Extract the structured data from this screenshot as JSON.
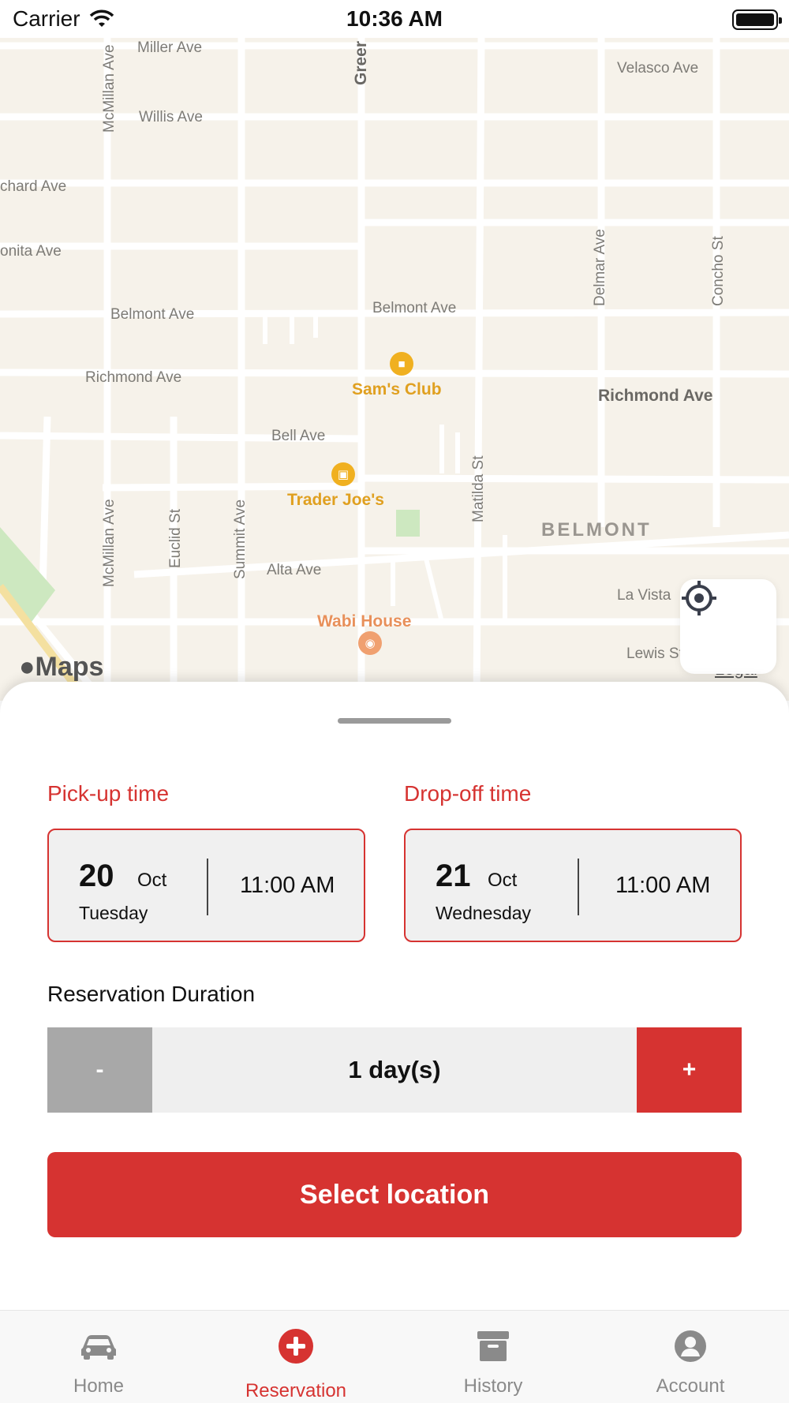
{
  "status_bar": {
    "carrier": "Carrier",
    "time": "10:36 AM"
  },
  "map": {
    "streets": {
      "miller": "Miller Ave",
      "willis": "Willis Ave",
      "orchard": "chard Ave",
      "bonita": "onita Ave",
      "belmont_w": "Belmont Ave",
      "belmont_e": "Belmont Ave",
      "richmond_w": "Richmond Ave",
      "richmond_e": "Richmond Ave",
      "bell": "Bell Ave",
      "alta": "Alta Ave",
      "velasco": "Velasco Ave",
      "la_vista": "La Vista",
      "lewis": "Lewis St",
      "mcmillan_n": "McMillan Ave",
      "mcmillan_s": "McMillan Ave",
      "euclid": "Euclid St",
      "summit": "Summit Ave",
      "matilda": "Matilda St",
      "delmar": "Delmar Ave",
      "concho": "Concho St",
      "greer": "Greer"
    },
    "district": "BELMONT",
    "pois": {
      "sams_club": "Sam's Club",
      "trader_joes": "Trader Joe's",
      "wabi_house": "Wabi House"
    },
    "brand": "Maps",
    "legal": "Legal",
    "locate_icon": "locate-crosshair-icon"
  },
  "reservation": {
    "pickup": {
      "label": "Pick-up time",
      "day": "20",
      "month": "Oct",
      "weekday": "Tuesday",
      "time": "11:00 AM"
    },
    "dropoff": {
      "label": "Drop-off time",
      "day": "21",
      "month": "Oct",
      "weekday": "Wednesday",
      "time": "11:00 AM"
    },
    "duration": {
      "label": "Reservation Duration",
      "minus": "-",
      "value": "1 day(s)",
      "plus": "+"
    },
    "select_location": "Select location"
  },
  "tabbar": {
    "items": [
      {
        "label": "Home",
        "icon": "car-icon",
        "active": false
      },
      {
        "label": "Reservation",
        "icon": "add-circle-icon",
        "active": true
      },
      {
        "label": "History",
        "icon": "archive-box-icon",
        "active": false
      },
      {
        "label": "Account",
        "icon": "user-circle-icon",
        "active": false
      }
    ]
  },
  "colors": {
    "accent": "#d63331",
    "map_bg": "#f6f2ea",
    "road": "#ffffff",
    "inactive": "#8a8a8a"
  }
}
